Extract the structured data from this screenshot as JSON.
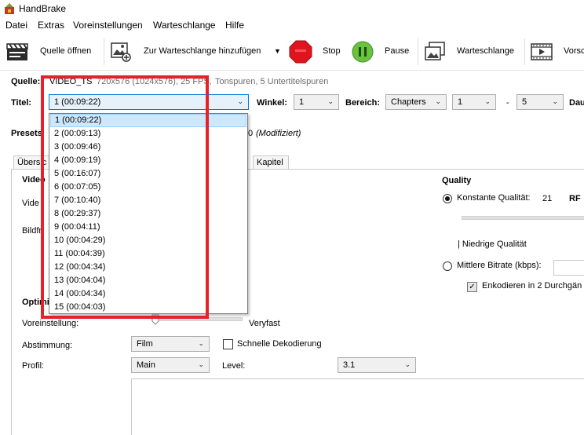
{
  "window": {
    "title": "HandBrake"
  },
  "menu": [
    "Datei",
    "Extras",
    "Voreinstellungen",
    "Warteschlange",
    "Hilfe"
  ],
  "toolbar": {
    "open_source": "Quelle öffnen",
    "add_queue": "Zur Warteschlange hinzufügen",
    "add_queue_arrow": "▼",
    "stop": "Stop",
    "pause": "Pause",
    "queue": "Warteschlange",
    "preview": "Vorsc"
  },
  "source": {
    "label": "Quelle:",
    "name": "VIDEO_TS",
    "info": "720x576 (1024x576), 25 FPS,",
    "tracks": "Tonspuren, 5 Untertitelspuren"
  },
  "title_row": {
    "label": "Titel:",
    "selected": "1 (00:09:22)",
    "angle_label": "Winkel:",
    "angle_value": "1",
    "range_label": "Bereich:",
    "range_type": "Chapters",
    "range_start": "1",
    "range_dash": "-",
    "range_end": "5",
    "duration_label": "Dau"
  },
  "presets": {
    "label": "Presets",
    "suffix": "0",
    "modified": "(Modifiziert)"
  },
  "tabs": {
    "summary": "Übersic",
    "chapters": "Kapitel"
  },
  "video": {
    "section_label": "Video",
    "codec_label": "Vide",
    "framerate_label": "Bildfr",
    "quality_label": "Quality",
    "constant_quality": "Konstante Qualität:",
    "rf_value": "21",
    "rf_label": "RF",
    "low_quality": "| Niedrige Qualität",
    "avg_bitrate": "Mittlere Bitrate (kbps):",
    "twopass": "Enkodieren in 2 Durchgän"
  },
  "optim": {
    "section_label": "Optimi",
    "preset_label": "Voreinstellung:",
    "preset_value": "Veryfast",
    "tune_label": "Abstimmung:",
    "tune_value": "Film",
    "fast_decode": "Schnelle Dekodierung",
    "profile_label": "Profil:",
    "profile_value": "Main",
    "level_label": "Level:",
    "level_value": "3.1"
  },
  "dropdown_items": [
    "1 (00:09:22)",
    "2 (00:09:13)",
    "3 (00:09:46)",
    "4 (00:09:19)",
    "5 (00:16:07)",
    "6 (00:07:05)",
    "7 (00:10:40)",
    "8 (00:29:37)",
    "9 (00:04:11)",
    "10 (00:04:29)",
    "11 (00:04:39)",
    "12 (00:04:34)",
    "13 (00:04:04)",
    "14 (00:04:34)",
    "15 (00:04:03)"
  ],
  "colors": {
    "highlight": "#e8202a",
    "selection": "#cce8ff"
  }
}
